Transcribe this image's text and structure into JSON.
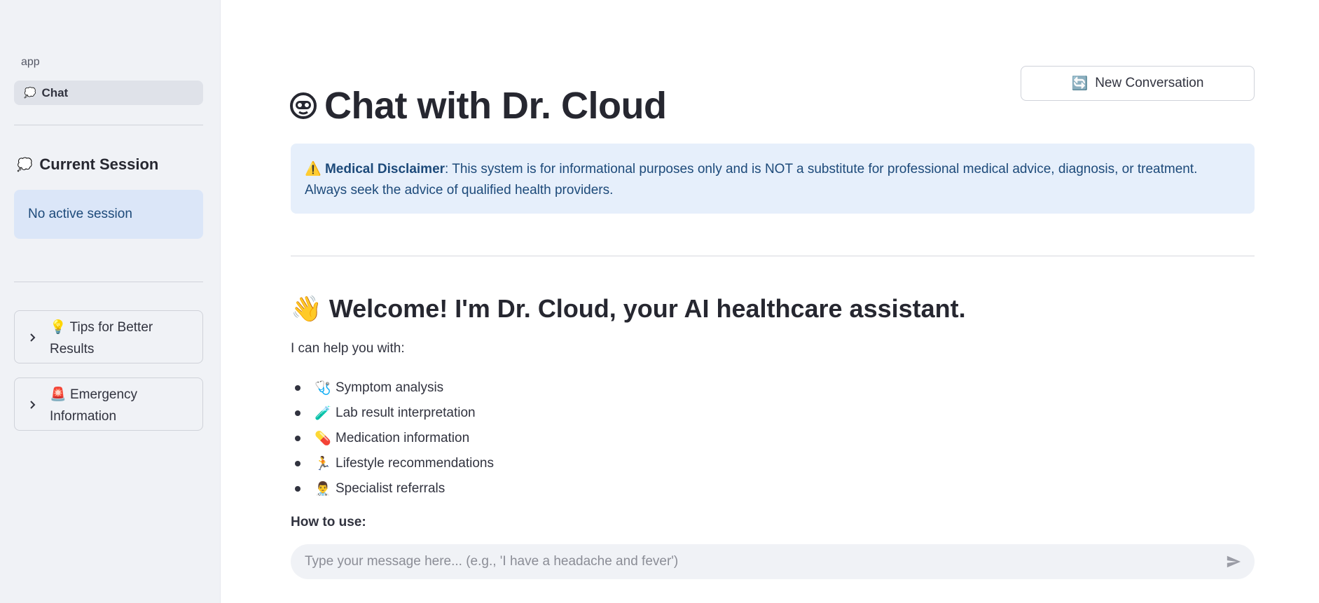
{
  "sidebar": {
    "nav_section": "app",
    "nav_items": [
      {
        "label": "Chat",
        "icon": "💭"
      }
    ],
    "session_heading": "Current Session",
    "session_icon": "💭",
    "session_status": "No active session",
    "expanders": [
      {
        "icon": "💡",
        "label": "Tips for Better Results"
      },
      {
        "icon": "🚨",
        "label": "Emergency Information"
      }
    ]
  },
  "header": {
    "new_conversation_label": "New Conversation",
    "new_conversation_icon": "🔄",
    "title": "Chat with Dr. Cloud"
  },
  "disclaimer": {
    "icon": "⚠️",
    "bold": "Medical Disclaimer",
    "text": ": This system is for informational purposes only and is NOT a substitute for professional medical advice, diagnosis, or treatment. Always seek the advice of qualified health providers."
  },
  "welcome": {
    "icon": "👋",
    "heading": "Welcome! I'm Dr. Cloud, your AI healthcare assistant.",
    "intro": "I can help you with:",
    "features": [
      {
        "icon": "🩺",
        "label": "Symptom analysis"
      },
      {
        "icon": "🧪",
        "label": "Lab result interpretation"
      },
      {
        "icon": "💊",
        "label": "Medication information"
      },
      {
        "icon": "🏃",
        "label": "Lifestyle recommendations"
      },
      {
        "icon": "👨‍⚕️",
        "label": "Specialist referrals"
      }
    ],
    "how_to": "How to use:"
  },
  "chat_input": {
    "placeholder": "Type your message here... (e.g., 'I have a headache and fever')",
    "value": ""
  }
}
